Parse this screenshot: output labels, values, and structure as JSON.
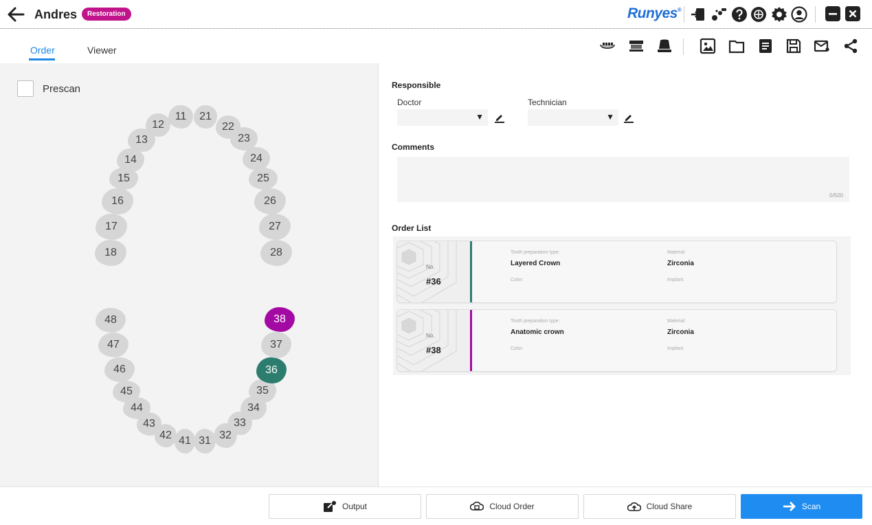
{
  "header": {
    "patient_name": "Andres",
    "mode_badge": "Restoration",
    "brand": "Runyes",
    "brand_mark": "®",
    "icons": [
      "import-icon",
      "remote-icon",
      "help-icon",
      "cloud-icon",
      "settings-icon",
      "account-icon",
      "minimize-icon",
      "close-icon"
    ]
  },
  "tabs": [
    {
      "label": "Order",
      "active": true
    },
    {
      "label": "Viewer",
      "active": false
    }
  ],
  "toolbar_icons": [
    "upper-jaw-icon",
    "lower-jaw-icon",
    "bite-icon",
    "image-icon",
    "folder-icon",
    "document-icon",
    "save-icon",
    "mail-icon",
    "share-icon"
  ],
  "prescan": {
    "label": "Prescan",
    "checked": false
  },
  "teeth": {
    "upper": [
      "11",
      "12",
      "13",
      "14",
      "15",
      "16",
      "17",
      "18",
      "21",
      "22",
      "23",
      "24",
      "25",
      "26",
      "27",
      "28"
    ],
    "lower": [
      "31",
      "32",
      "33",
      "34",
      "35",
      "36",
      "37",
      "38",
      "41",
      "42",
      "43",
      "44",
      "45",
      "46",
      "47",
      "48"
    ],
    "selected": {
      "36": "#2d7d6f",
      "38": "#a30aa3"
    }
  },
  "responsible": {
    "title": "Responsible",
    "doctor_label": "Doctor",
    "doctor_value": "",
    "technician_label": "Technician",
    "technician_value": ""
  },
  "comments": {
    "title": "Comments",
    "value": "",
    "counter": "0/500"
  },
  "order_list": {
    "title": "Order List",
    "no_label": "No.",
    "prep_label": "Tooth preparation type:",
    "material_label": "Material:",
    "color_label": "Color:",
    "implant_label": "Implant:",
    "items": [
      {
        "number": "#36",
        "prep_type": "Layered Crown",
        "material": "Zirconia",
        "color": "",
        "implant": "",
        "accent": "#2d7d6f"
      },
      {
        "number": "#38",
        "prep_type": "Anatomic crown",
        "material": "Zirconia",
        "color": "",
        "implant": "",
        "accent": "#a30aa3"
      }
    ]
  },
  "footer": {
    "output": "Output",
    "cloud_order": "Cloud Order",
    "cloud_share": "Cloud Share",
    "scan": "Scan"
  },
  "colors": {
    "accent": "#1e88e5",
    "badge": "#c0138c",
    "brand": "#1f6fd6",
    "scan_button": "#1e8cf0"
  }
}
